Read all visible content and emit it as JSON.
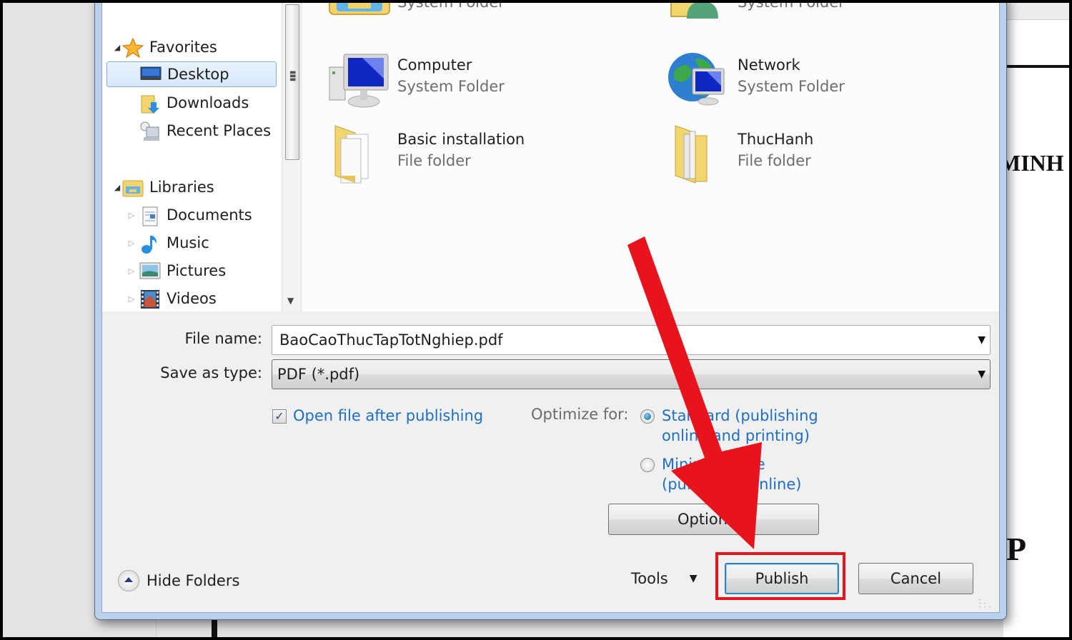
{
  "background_document": {
    "visible_text_fragments": [
      "MINH",
      "P"
    ]
  },
  "navigation": {
    "groups": [
      {
        "label": "Favorites",
        "icon": "star-icon",
        "expanded": true,
        "items": [
          {
            "label": "Desktop",
            "icon": "desktop-icon",
            "selected": true
          },
          {
            "label": "Downloads",
            "icon": "downloads-folder-icon",
            "selected": false
          },
          {
            "label": "Recent Places",
            "icon": "recent-places-icon",
            "selected": false
          }
        ]
      },
      {
        "label": "Libraries",
        "icon": "libraries-icon",
        "expanded": true,
        "items": [
          {
            "label": "Documents",
            "icon": "documents-icon",
            "expandable": true
          },
          {
            "label": "Music",
            "icon": "music-note-icon",
            "expandable": true
          },
          {
            "label": "Pictures",
            "icon": "pictures-icon",
            "expandable": true
          },
          {
            "label": "Videos",
            "icon": "videos-icon",
            "expandable": true
          }
        ]
      }
    ]
  },
  "files": [
    {
      "name": "",
      "type": "System Folder",
      "icon": "libraries-folder-icon",
      "partially_visible": true
    },
    {
      "name": "",
      "type": "System Folder",
      "icon": "user-folder-icon",
      "partially_visible": true
    },
    {
      "name": "Computer",
      "type": "System Folder",
      "icon": "computer-icon"
    },
    {
      "name": "Network",
      "type": "System Folder",
      "icon": "network-globe-icon"
    },
    {
      "name": "Basic installation",
      "type": "File folder",
      "icon": "folder-icon"
    },
    {
      "name": "ThucHanh",
      "type": "File folder",
      "icon": "folder-icon"
    }
  ],
  "form": {
    "file_name_label": "File name:",
    "file_name_value": "BaoCaoThucTapTotNghiep.pdf",
    "save_as_type_label": "Save as type:",
    "save_as_type_value": "PDF (*.pdf)",
    "open_after_publishing": {
      "label": "Open file after publishing",
      "checked": true
    },
    "optimize_for_label": "Optimize for:",
    "optimize_options": [
      {
        "line1": "Standard (publishing",
        "line2": "online and printing)",
        "selected": true
      },
      {
        "line1": "Minimum size",
        "line2": "(publishing online)",
        "selected": false
      }
    ],
    "options_button": "Options..."
  },
  "footer": {
    "hide_folders_label": "Hide Folders",
    "tools_label": "Tools",
    "publish_button": "Publish",
    "cancel_button": "Cancel"
  },
  "annotation": {
    "color": "#e8141c",
    "target": "publish-button"
  }
}
